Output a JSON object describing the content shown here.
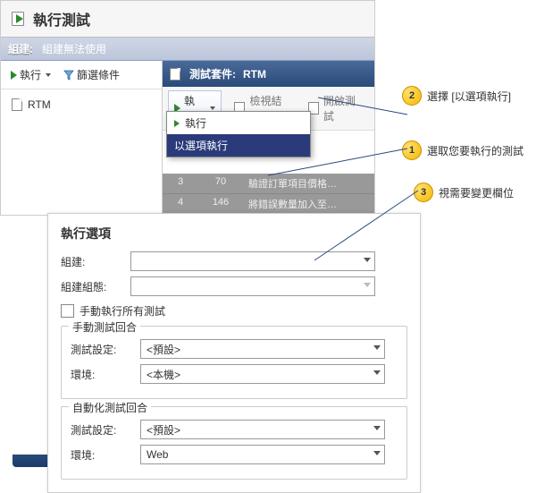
{
  "title": "執行測試",
  "build_section": {
    "label": "組建:",
    "value": "組建無法使用"
  },
  "left_toolbar": {
    "run": "執行",
    "filter": "篩選條件"
  },
  "tree": {
    "item1": "RTM"
  },
  "suite": {
    "prefix": "測試套件:",
    "name": "RTM",
    "toolbar": {
      "run": "執行",
      "view_results": "檢視結果",
      "open_tests": "開啟測試"
    }
  },
  "dropdown": {
    "run": "執行",
    "run_with_options": "以選項執行"
  },
  "grid": {
    "rows": [
      {
        "n": "3",
        "id": "70",
        "title": "驗證訂單項目價格…"
      },
      {
        "n": "4",
        "id": "146",
        "title": "將錯誤數量加入至…"
      }
    ]
  },
  "dialog": {
    "title": "執行選項",
    "build": "組建:",
    "build_config": "組建組態:",
    "manual_all": "手動執行所有測試",
    "group_manual": "手動測試回合",
    "group_auto": "自動化測試回合",
    "test_settings": "測試設定:",
    "environment": "環境:",
    "sel_default": "<預設>",
    "sel_local": "<本機>",
    "sel_web": "Web"
  },
  "callouts": {
    "c1": "選取您要執行的測試",
    "c2": "選擇 [以選項執行]",
    "c3": "視需要變更欄位"
  }
}
